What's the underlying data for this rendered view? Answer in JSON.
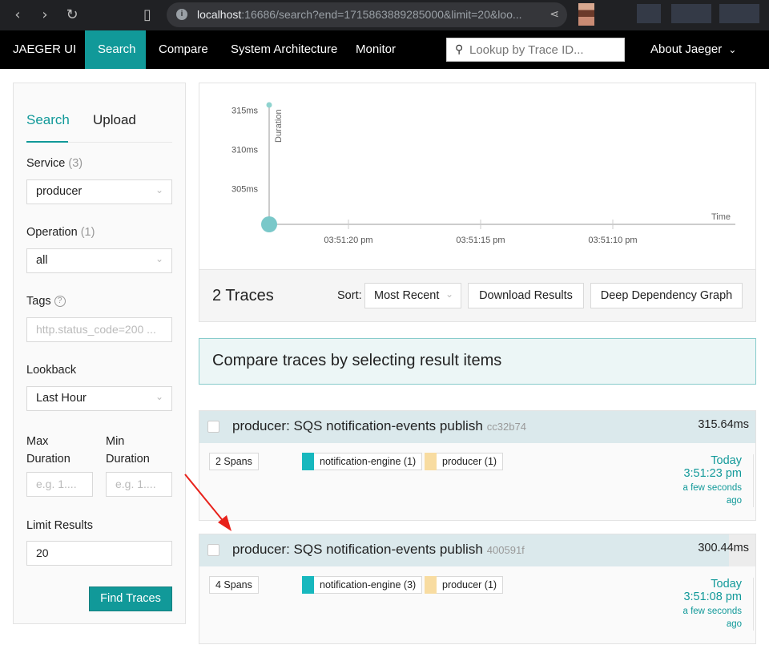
{
  "browser": {
    "url_host": "localhost",
    "url_rest": ":16686/search?end=1715863889285000&limit=20&loo..."
  },
  "topnav": {
    "brand": "JAEGER UI",
    "items": [
      "Search",
      "Compare",
      "System Architecture",
      "Monitor"
    ],
    "active": "Search",
    "lookup_placeholder": "Lookup by Trace ID...",
    "about": "About Jaeger"
  },
  "search": {
    "tabs": [
      "Search",
      "Upload"
    ],
    "service_label": "Service",
    "service_count": "(3)",
    "service_value": "producer",
    "operation_label": "Operation",
    "operation_count": "(1)",
    "operation_value": "all",
    "tags_label": "Tags",
    "tags_placeholder": "http.status_code=200 ...",
    "lookback_label": "Lookback",
    "lookback_value": "Last Hour",
    "max_duration_label_1": "Max",
    "max_duration_label_2": "Duration",
    "min_duration_label_1": "Min",
    "min_duration_label_2": "Duration",
    "duration_placeholder": "e.g. 1....",
    "limit_label": "Limit Results",
    "limit_value": "20",
    "find_button": "Find Traces"
  },
  "chart_data": {
    "type": "scatter",
    "ylabel": "Duration",
    "xlabel": "Time",
    "y_ticks": [
      "305ms",
      "310ms",
      "315ms"
    ],
    "x_ticks": [
      "03:51:10 pm",
      "03:51:15 pm",
      "03:51:20 pm"
    ],
    "points": [
      {
        "x": "03:51:08 pm",
        "y": 300.44
      },
      {
        "x": "03:51:23 pm",
        "y": 315.64
      }
    ]
  },
  "results": {
    "count_label": "2 Traces",
    "sort_label": "Sort:",
    "sort_value": "Most Recent",
    "download_button": "Download Results",
    "ddg_button": "Deep Dependency Graph",
    "compare_banner": "Compare traces by selecting result items"
  },
  "traces": [
    {
      "title": "producer: SQS notification-events publish",
      "trace_id": "cc32b74",
      "duration": "315.64ms",
      "duration_fraction": 1.0,
      "spans": "2 Spans",
      "services": [
        {
          "label": "notification-engine (1)",
          "color": "#17b8be"
        },
        {
          "label": "producer (1)",
          "color": "#f8dca1"
        }
      ],
      "day": "Today",
      "time": "3:51:23 pm",
      "ago_1": "a few seconds",
      "ago_2": "ago"
    },
    {
      "title": "producer: SQS notification-events publish",
      "trace_id": "400591f",
      "duration": "300.44ms",
      "duration_fraction": 0.952,
      "spans": "4 Spans",
      "services": [
        {
          "label": "notification-engine (3)",
          "color": "#17b8be"
        },
        {
          "label": "producer (1)",
          "color": "#f8dca1"
        }
      ],
      "day": "Today",
      "time": "3:51:08 pm",
      "ago_1": "a few seconds",
      "ago_2": "ago"
    }
  ]
}
